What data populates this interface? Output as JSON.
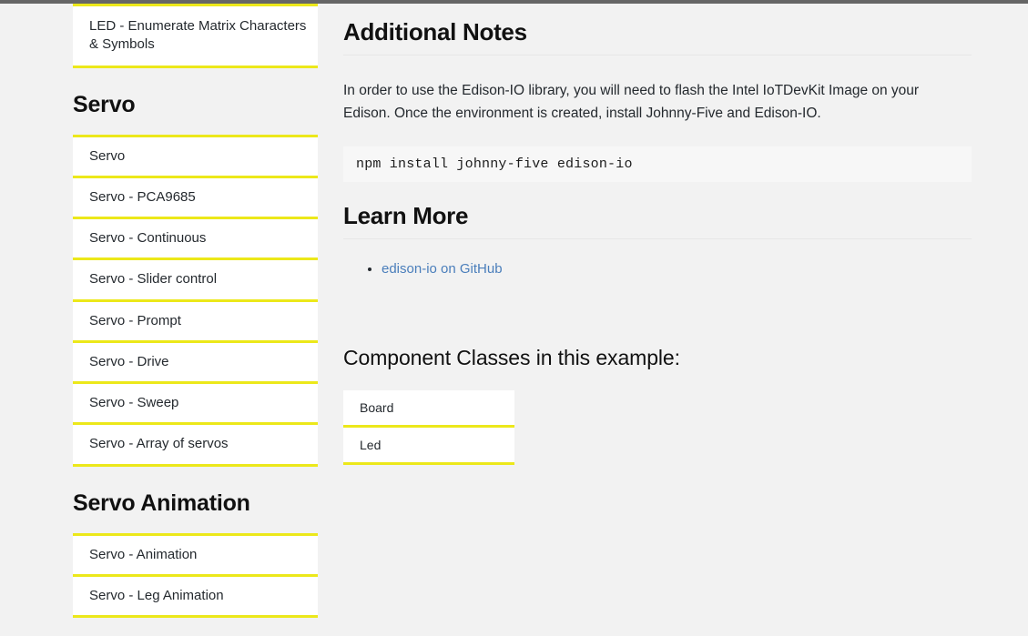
{
  "sidebar": {
    "top_card": {
      "items": [
        {
          "label": "LED - Enumerate Matrix Characters & Symbols"
        }
      ]
    },
    "sections": [
      {
        "heading": "Servo",
        "items": [
          {
            "label": "Servo"
          },
          {
            "label": "Servo - PCA9685"
          },
          {
            "label": "Servo - Continuous"
          },
          {
            "label": "Servo - Slider control"
          },
          {
            "label": "Servo - Prompt"
          },
          {
            "label": "Servo - Drive"
          },
          {
            "label": "Servo - Sweep"
          },
          {
            "label": "Servo - Array of servos"
          }
        ]
      },
      {
        "heading": "Servo Animation",
        "items": [
          {
            "label": "Servo - Animation"
          },
          {
            "label": "Servo - Leg Animation"
          }
        ]
      }
    ]
  },
  "main": {
    "additional_notes": {
      "heading": "Additional Notes",
      "paragraph": "In order to use the Edison-IO library, you will need to flash the Intel IoTDevKit Image on your Edison. Once the environment is created, install Johnny-Five and Edison-IO.",
      "code": "npm install johnny-five edison-io"
    },
    "learn_more": {
      "heading": "Learn More",
      "links": [
        {
          "label": "edison-io on GitHub"
        }
      ]
    },
    "component_classes": {
      "heading": "Component Classes in this example:",
      "items": [
        {
          "label": "Board"
        },
        {
          "label": "Led"
        }
      ]
    }
  },
  "colors": {
    "accent_yellow": "#ece81a",
    "page_background": "#f2f2f2",
    "card_background": "#ffffff",
    "link_blue": "#4a7ebb",
    "top_edge_gray": "#666666",
    "text": "#24292e"
  }
}
